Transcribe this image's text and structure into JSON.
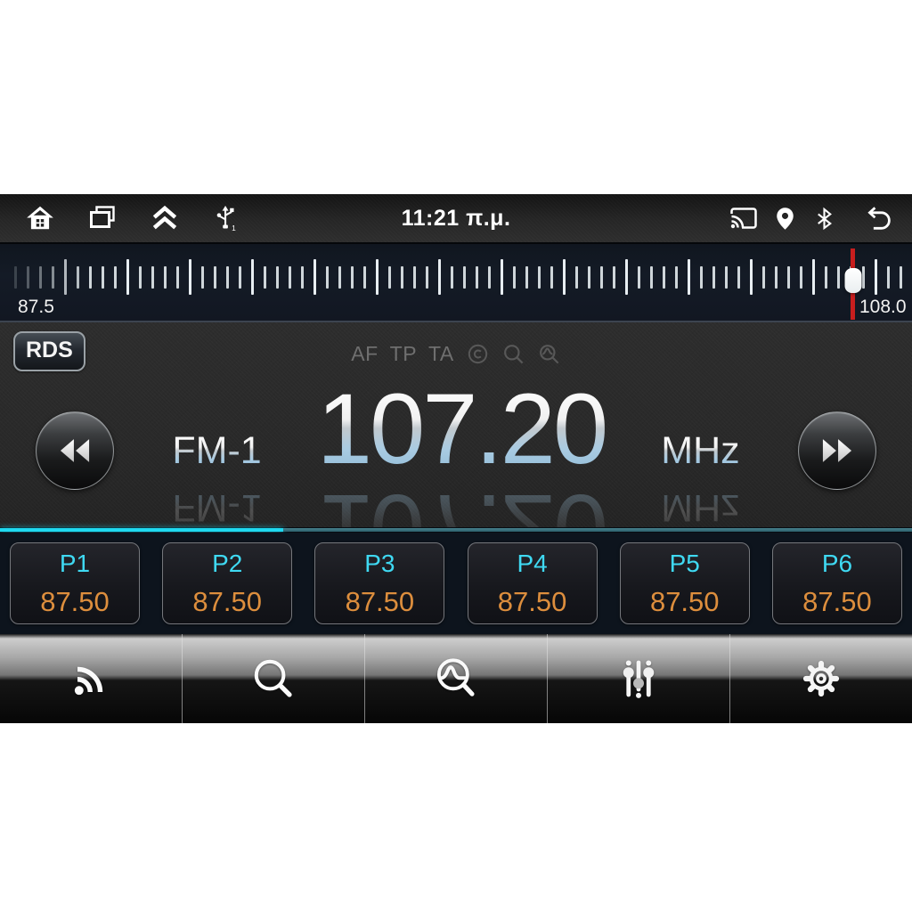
{
  "statusbar": {
    "time": "11:21 π.μ.",
    "usb_count": "1"
  },
  "tuner_scale": {
    "min": 87.5,
    "max": 108.0,
    "min_label": "87.5",
    "max_label": "108.0",
    "current": 107.2
  },
  "radio": {
    "rds_label": "RDS",
    "af_label": "AF",
    "tp_label": "TP",
    "ta_label": "TA",
    "band_label": "FM-1",
    "frequency": "107.20",
    "unit_label": "MHz"
  },
  "presets": [
    {
      "label": "P1",
      "value": "87.50"
    },
    {
      "label": "P2",
      "value": "87.50"
    },
    {
      "label": "P3",
      "value": "87.50"
    },
    {
      "label": "P4",
      "value": "87.50"
    },
    {
      "label": "P5",
      "value": "87.50"
    },
    {
      "label": "P6",
      "value": "87.50"
    }
  ],
  "colors": {
    "accent_cyan": "#1fd9f0",
    "preset_label_cyan": "#3fd9f2",
    "preset_value_orange": "#dd8e3d",
    "tuner_indicator_red": "#c81e1e"
  }
}
